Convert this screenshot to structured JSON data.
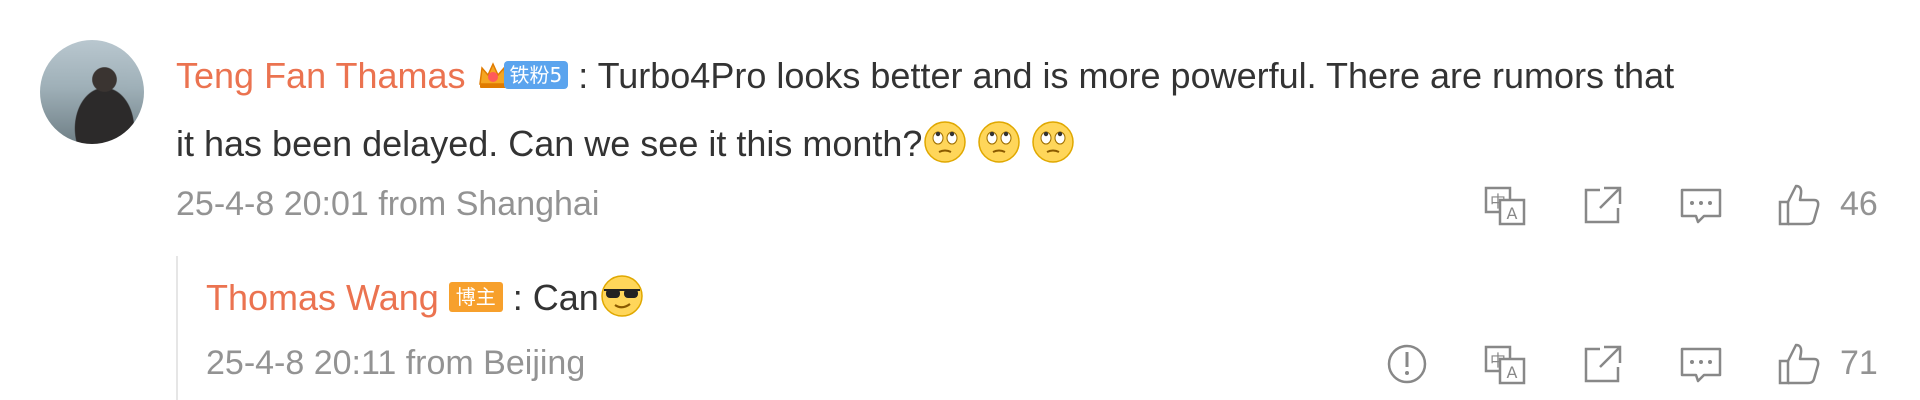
{
  "comment": {
    "author": "Teng Fan Thamas",
    "fan_badge": "铁粉5",
    "text_line1": ": Turbo4Pro looks better and is more powerful. There are rumors that",
    "text_line2": "it has been delayed. Can we see it this month?",
    "emojis": [
      "rolling-eyes-emoji",
      "rolling-eyes-emoji",
      "rolling-eyes-emoji"
    ],
    "timestamp": "25-4-8 20:01 from Shanghai",
    "likes": "46"
  },
  "reply": {
    "author": "Thomas Wang",
    "owner_badge": "博主",
    "text": ": Can",
    "emoji": "sunglasses-emoji",
    "timestamp": "25-4-8 20:11 from Beijing",
    "likes": "71"
  },
  "icons": [
    "translate-icon",
    "share-icon",
    "comment-icon",
    "like-icon",
    "report-icon"
  ],
  "colors": {
    "name": "#eb7350",
    "meta": "#939393",
    "fan_badge": "#5ba4ee",
    "owner_badge": "#f7a02c"
  }
}
